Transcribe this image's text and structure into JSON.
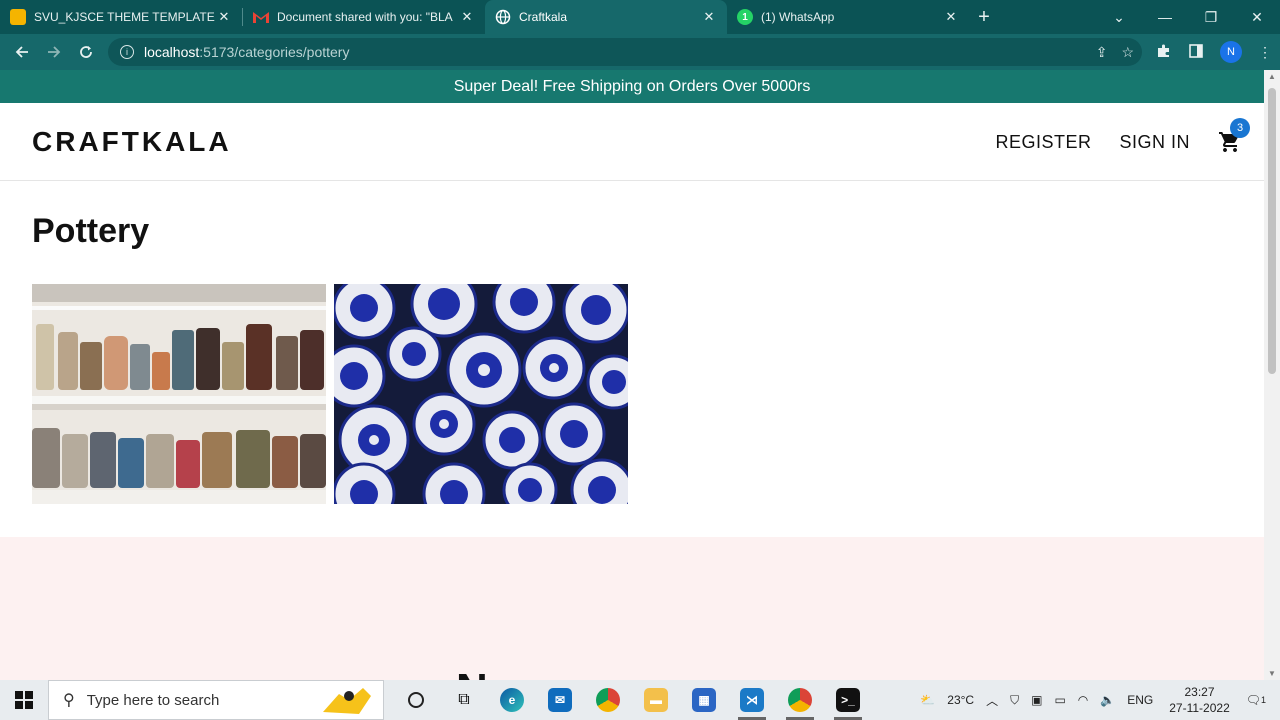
{
  "browser": {
    "tabs": [
      {
        "title": "SVU_KJSCE THEME TEMPLATE FO",
        "favicon_color": "#f5b400",
        "active": false
      },
      {
        "title": "Document shared with you: \"BLA",
        "favicon_color": "#d93025",
        "active": false
      },
      {
        "title": "Craftkala",
        "favicon_color": "#ffffff",
        "active": true
      },
      {
        "title": "(1) WhatsApp",
        "favicon_color": "#25d366",
        "active": false
      }
    ],
    "new_tab_label": "+",
    "url_host": "localhost",
    "url_path": ":5173/categories/pottery",
    "profile_initial": "N"
  },
  "page": {
    "promo_text": "Super Deal! Free Shipping on Orders Over 5000rs",
    "logo": "CRAFTKALA",
    "nav": {
      "register": "REGISTER",
      "sign_in": "SIGN IN"
    },
    "cart_count": "3",
    "category_title": "Pottery",
    "products": [
      {
        "name": "pottery-cups-shelf"
      },
      {
        "name": "blue-pottery-bowls"
      }
    ],
    "partial_heading": "N"
  },
  "taskbar": {
    "search_placeholder": "Type here to search",
    "weather_temp": "23°C",
    "language": "ENG",
    "time": "23:27",
    "date": "27-11-2022",
    "notifications": "1"
  },
  "colors": {
    "chrome_dark": "#0b5355",
    "chrome_toolbar": "#16686a",
    "promo_bg": "#17786f",
    "badge": "#1976d2",
    "newsletter_bg": "#fdf1f1"
  }
}
